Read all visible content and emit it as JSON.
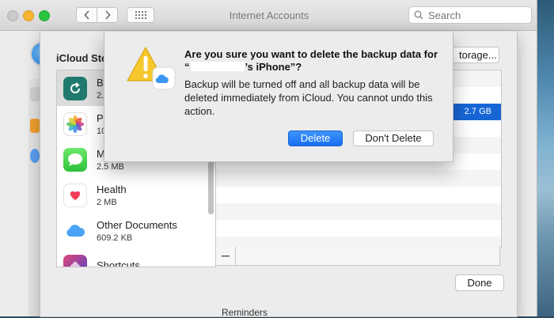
{
  "window": {
    "title": "Internet Accounts",
    "search_placeholder": "Search"
  },
  "storage_sheet": {
    "title_partial": "iCloud Sto",
    "manage_button_partial": "torage...",
    "done_label": "Done",
    "apps": [
      {
        "name": "Ba",
        "size": "2.",
        "icon": "backup-icon",
        "selected": true
      },
      {
        "name": "Ph",
        "size": "10",
        "icon": "photos-icon",
        "selected": false
      },
      {
        "name": "M",
        "size": "2.5 MB",
        "icon": "messages-icon",
        "selected": false
      },
      {
        "name": "Health",
        "size": "2 MB",
        "icon": "health-icon",
        "selected": false
      },
      {
        "name": "Other Documents",
        "size": "609.2 KB",
        "icon": "icloud-icon",
        "selected": false
      },
      {
        "name": "Shortcuts",
        "size": "",
        "icon": "shortcuts-icon",
        "selected": false
      }
    ],
    "detail_selected_size": "2.7 GB",
    "underlying_row": "Reminders"
  },
  "alert": {
    "heading_pre": "Are you sure you want to delete the backup data for “",
    "heading_post": "’s iPhone”?",
    "body": "Backup will be turned off and all backup data will be deleted immediately from iCloud. You cannot undo this action.",
    "delete_label": "Delete",
    "dont_delete_label": "Don't Delete"
  },
  "colors": {
    "accent": "#176ff2",
    "selection": "#1766d6",
    "warning": "#f7c82d"
  }
}
